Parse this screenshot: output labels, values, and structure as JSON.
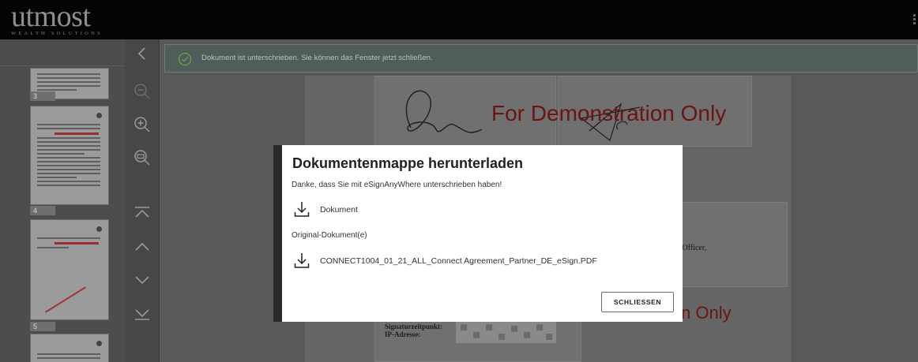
{
  "brand": {
    "name": "utmost",
    "tagline": "WEALTH SOLUTIONS"
  },
  "thumbnails": [
    {
      "page_number": "3"
    },
    {
      "page_number": "4"
    },
    {
      "page_number": "5"
    }
  ],
  "notification": {
    "message": "Dokument ist unterschrieben. Sie können das Fenster jetzt schließen.",
    "status_color": "#6aa34d"
  },
  "document": {
    "watermark_top": "For Demonstration Only",
    "watermark_bottom": "n Only",
    "officer_fragment": "g Officer,",
    "signature_time_label": "Signaturzeitpunkt:",
    "ip_label": "IP-Adresse:"
  },
  "modal": {
    "title": "Dokumentenmappe herunterladen",
    "subtitle": "Danke, dass Sie mit eSignAnyWhere unterschrieben haben!",
    "document_link": "Dokument",
    "originals_heading": "Original-Dokument(e)",
    "original_file": "CONNECT1004_01_21_ALL_Connect Agreement_Partner_DE_eSign.PDF",
    "close_button": "SCHLIESSEN"
  },
  "icons": {
    "collapse": "chevron-left-icon",
    "zoom_out": "zoom-out-icon",
    "zoom_in": "zoom-in-icon",
    "fit_width": "fit-width-icon",
    "first_page": "first-page-icon",
    "previous_page": "chevron-up-icon",
    "next_page": "chevron-down-icon",
    "last_page": "last-page-icon",
    "download": "download-icon",
    "success": "check-circle-icon"
  },
  "colors": {
    "watermark": "#a01717",
    "overlay_dim": "#595959",
    "notice_bg": "#4f5d5b"
  }
}
